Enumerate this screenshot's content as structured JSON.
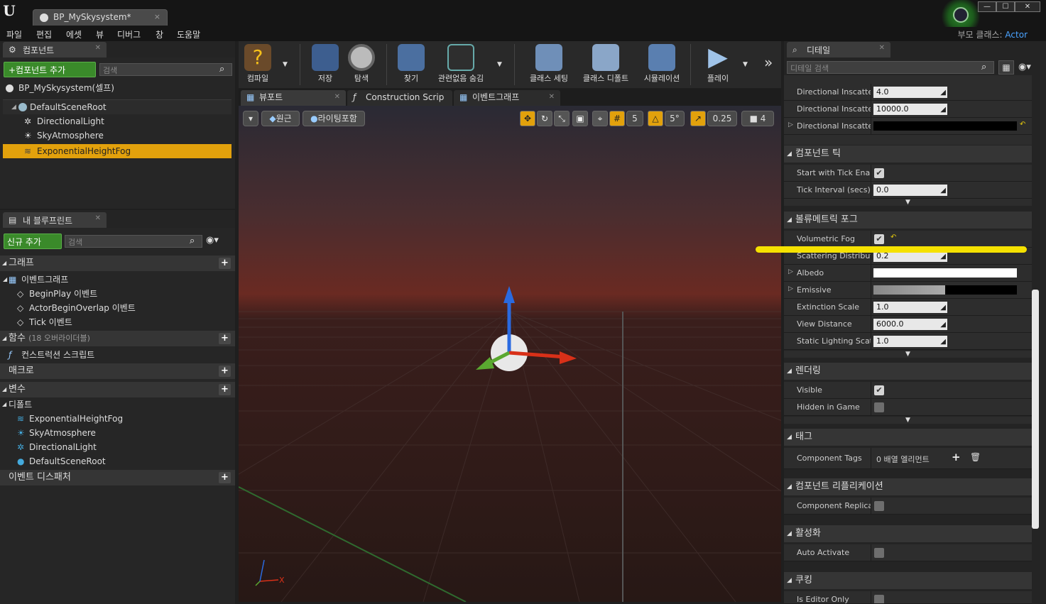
{
  "window": {
    "tab_title": "BP_MySkysystem*",
    "tab_close": "×",
    "logo": "U"
  },
  "menu": [
    "파일",
    "편집",
    "에셋",
    "뷰",
    "디버그",
    "창",
    "도움말"
  ],
  "parent_class": {
    "label": "부모 클래스:",
    "value": "Actor"
  },
  "window_buttons": [
    "—",
    "☐",
    "✕"
  ],
  "components": {
    "tab": "컴포넌트",
    "add_button": "+컴포넌트 추가",
    "search_placeholder": "검색",
    "self_item": "BP_MySkysystem(셀프)",
    "tree": [
      "DefaultSceneRoot",
      "DirectionalLight",
      "SkyAtmosphere",
      "ExponentialHeightFog"
    ]
  },
  "my_blueprint": {
    "tab": "내 블루프린트",
    "add_button": "신규 추가",
    "search_placeholder": "검색",
    "graph_header": "그래프",
    "event_graph": "이벤트그래프",
    "events": [
      "BeginPlay 이벤트",
      "ActorBeginOverlap 이벤트",
      "Tick 이벤트"
    ],
    "functions_header": "함수",
    "functions_note": "(18 오버라이더블)",
    "construction_script": "컨스트럭션 스크립트",
    "macros_header": "매크로",
    "variables_header": "변수",
    "defaults_header": "디폴트",
    "defaults": [
      "ExponentialHeightFog",
      "SkyAtmosphere",
      "DirectionalLight",
      "DefaultSceneRoot"
    ],
    "dispatchers_header": "이벤트 디스패처"
  },
  "toolbar": {
    "compile": "컴파일",
    "save": "저장",
    "browse": "탐색",
    "find": "찾기",
    "hide_unrelated": "관련없음 숨김",
    "class_settings": "클래스 세팅",
    "class_defaults": "클래스 디폴트",
    "simulate": "시뮬레이션",
    "play": "플레이"
  },
  "viewport_tabs": [
    "뷰포트",
    "Construction Scrip",
    "이벤트그래프"
  ],
  "viewport_toolbar": {
    "perspective": "원근",
    "lit": "라이팅포함",
    "grid_snap": "5",
    "rot_snap": "5°",
    "scale_snap": "0.25",
    "cam_speed": "4"
  },
  "details": {
    "tab": "디테일",
    "search_placeholder": "디테일 검색",
    "rows_top": [
      {
        "name": "Directional Inscatteri",
        "value": "4.0"
      },
      {
        "name": "Directional Inscatteri",
        "value": "10000.0"
      },
      {
        "name": "Directional Inscatter",
        "value": ""
      }
    ],
    "sec_tick": "컴포넌트 틱",
    "start_with_tick": "Start with Tick Enabl",
    "tick_interval": {
      "name": "Tick Interval (secs)",
      "value": "0.0"
    },
    "sec_volumetric": "볼류메트릭 포그",
    "volumetric_fog": "Volumetric Fog",
    "scattering": {
      "name": "Scattering Distributic",
      "value": "0.2"
    },
    "albedo": "Albedo",
    "emissive": "Emissive",
    "extinction": {
      "name": "Extinction Scale",
      "value": "1.0"
    },
    "view_distance": {
      "name": "View Distance",
      "value": "6000.0"
    },
    "static_lighting": {
      "name": "Static Lighting Scatt",
      "value": "1.0"
    },
    "sec_rendering": "렌더링",
    "visible": "Visible",
    "hidden_in_game": "Hidden in Game",
    "sec_tags": "태그",
    "component_tags": {
      "name": "Component Tags",
      "value": "0 배열 엘리먼트"
    },
    "sec_replication": "컴포넌트 리플리케이션",
    "component_replicates": "Component Replicate",
    "sec_activation": "활성화",
    "auto_activate": "Auto Activate",
    "sec_cooking": "쿠킹",
    "is_editor_only": "Is Editor Only"
  }
}
